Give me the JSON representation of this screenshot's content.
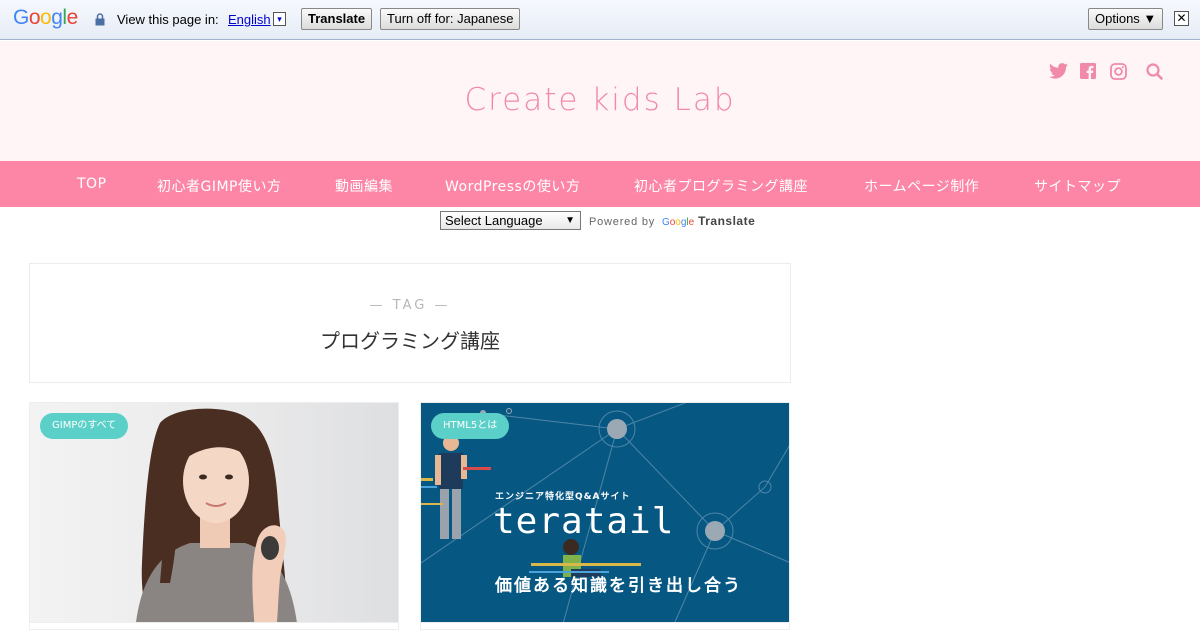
{
  "translate_bar": {
    "logo": "Google",
    "view_text": "View this page in:",
    "language": "English",
    "lang_arrow": "▾",
    "translate_button": "Translate",
    "turn_off_button": "Turn off for: Japanese",
    "options_button": "Options ▼",
    "close": "✕"
  },
  "header": {
    "site_title": "Create kids Lab",
    "icons": [
      "twitter-icon",
      "facebook-icon",
      "instagram-icon",
      "search-icon"
    ],
    "accent_color": "#f08aa8"
  },
  "nav": {
    "background": "#fd86a7",
    "items": [
      "TOP",
      "初心者GIMP使い方",
      "動画編集",
      "WordPressの使い方",
      "初心者プログラミング講座",
      "ホームページ制作",
      "サイトマップ"
    ]
  },
  "translate_widget": {
    "select_value": "Select Language",
    "powered_by": "Powered by",
    "google": "Google",
    "translate": "Translate"
  },
  "archive": {
    "label": "— TAG —",
    "title": "プログラミング講座"
  },
  "cards": [
    {
      "badge": "GIMPのすべて"
    },
    {
      "badge": "HTML5とは",
      "subtitle": "エンジニア特化型Q&Aサイト",
      "logo": "teratail",
      "tagline": "価値ある知識を引き出し合う"
    }
  ]
}
